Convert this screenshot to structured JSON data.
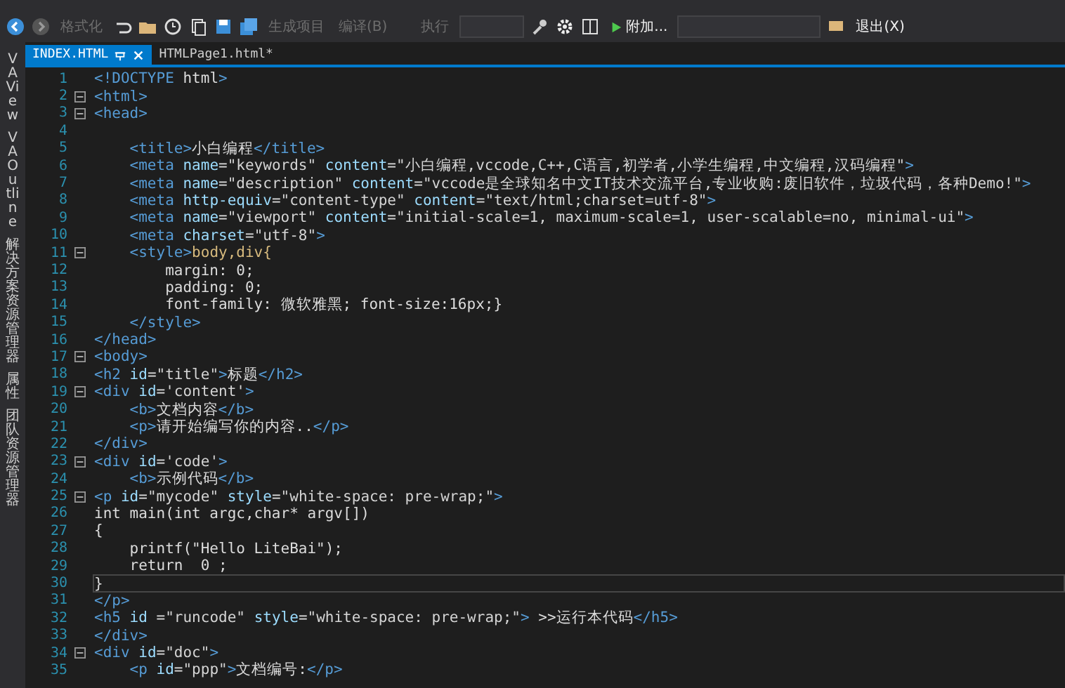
{
  "toolbar": {
    "format_button": {
      "label": "格式化",
      "disabled": true
    },
    "build_button": {
      "label": "生成项目",
      "disabled": true
    },
    "compile_button": {
      "label": "编译(B)",
      "disabled": true
    },
    "run_button": {
      "label": "执行",
      "disabled": true
    },
    "attach_button": {
      "label": "附加...",
      "disabled": false
    },
    "exit_button": {
      "label": "退出(X)",
      "disabled": false
    }
  },
  "side_tabs": [
    "VA View",
    "VA Outline",
    "解决方案资源管理器",
    "属性",
    "团队资源管理器"
  ],
  "editor_tabs": [
    {
      "label": "INDEX.HTML",
      "selected": true
    },
    {
      "label": "HTMLPage1.html*",
      "selected": false
    }
  ],
  "code_lines": [
    {
      "number": "1",
      "fold": false,
      "current": false,
      "tokens": [
        {
          "kind": "tag",
          "text": "<!DOCTYPE"
        },
        {
          "kind": "text",
          "text": " html"
        },
        {
          "kind": "tag",
          "text": ">"
        }
      ]
    },
    {
      "number": "2",
      "fold": true,
      "current": false,
      "tokens": [
        {
          "kind": "tag",
          "text": "<html>"
        }
      ]
    },
    {
      "number": "3",
      "fold": true,
      "current": false,
      "tokens": [
        {
          "kind": "tag",
          "text": "<head>"
        }
      ]
    },
    {
      "number": "4",
      "fold": false,
      "current": false
    },
    {
      "number": "5",
      "fold": false,
      "current": false,
      "tokens": [
        {
          "kind": "tag",
          "text": "    <title>"
        },
        {
          "kind": "text",
          "text": "小白编程"
        },
        {
          "kind": "tag",
          "text": "</title>"
        }
      ]
    },
    {
      "number": "6",
      "fold": false,
      "current": false,
      "tokens": [
        {
          "kind": "tag",
          "text": "    <meta"
        },
        {
          "kind": "attr",
          "text": " name"
        },
        {
          "kind": "text",
          "text": "="
        },
        {
          "kind": "str",
          "text": "\"keywords\""
        },
        {
          "kind": "attr",
          "text": " content"
        },
        {
          "kind": "text",
          "text": "="
        },
        {
          "kind": "str",
          "text": "\"小白编程,vccode,C++,C语言,初学者,小学生编程,中文编程,汉码编程\""
        },
        {
          "kind": "tag",
          "text": ">"
        }
      ]
    },
    {
      "number": "7",
      "fold": false,
      "current": false,
      "tokens": [
        {
          "kind": "tag",
          "text": "    <meta"
        },
        {
          "kind": "attr",
          "text": " name"
        },
        {
          "kind": "text",
          "text": "="
        },
        {
          "kind": "str",
          "text": "\"description\""
        },
        {
          "kind": "attr",
          "text": " content"
        },
        {
          "kind": "text",
          "text": "="
        },
        {
          "kind": "str",
          "text": "\"vccode是全球知名中文IT技术交流平台,专业收购:废旧软件，垃圾代码，各种Demo!\""
        },
        {
          "kind": "tag",
          "text": ">"
        }
      ]
    },
    {
      "number": "8",
      "fold": false,
      "current": false,
      "tokens": [
        {
          "kind": "tag",
          "text": "    <meta"
        },
        {
          "kind": "attr",
          "text": " http-equiv"
        },
        {
          "kind": "text",
          "text": "="
        },
        {
          "kind": "str",
          "text": "\"content-type\""
        },
        {
          "kind": "attr",
          "text": " content"
        },
        {
          "kind": "text",
          "text": "="
        },
        {
          "kind": "str",
          "text": "\"text/html;charset=utf-8\""
        },
        {
          "kind": "tag",
          "text": ">"
        }
      ]
    },
    {
      "number": "9",
      "fold": false,
      "current": false,
      "tokens": [
        {
          "kind": "tag",
          "text": "    <meta"
        },
        {
          "kind": "attr",
          "text": " name"
        },
        {
          "kind": "text",
          "text": "="
        },
        {
          "kind": "str",
          "text": "\"viewport\""
        },
        {
          "kind": "attr",
          "text": " content"
        },
        {
          "kind": "text",
          "text": "="
        },
        {
          "kind": "str",
          "text": "\"initial-scale=1, maximum-scale=1, user-scalable=no, minimal-ui\""
        },
        {
          "kind": "tag",
          "text": ">"
        }
      ]
    },
    {
      "number": "10",
      "fold": false,
      "current": false,
      "tokens": [
        {
          "kind": "tag",
          "text": "    <meta"
        },
        {
          "kind": "attr",
          "text": " charset"
        },
        {
          "kind": "text",
          "text": "="
        },
        {
          "kind": "str",
          "text": "\"utf-8\""
        },
        {
          "kind": "tag",
          "text": ">"
        }
      ]
    },
    {
      "number": "11",
      "fold": true,
      "current": false,
      "tokens": [
        {
          "kind": "tag",
          "text": "    <style>"
        },
        {
          "kind": "css",
          "text": "body,div{"
        }
      ]
    },
    {
      "number": "12",
      "fold": false,
      "current": false,
      "tokens": [
        {
          "kind": "text",
          "text": "        margin: 0;"
        }
      ]
    },
    {
      "number": "13",
      "fold": false,
      "current": false,
      "tokens": [
        {
          "kind": "text",
          "text": "        padding: 0;"
        }
      ]
    },
    {
      "number": "14",
      "fold": false,
      "current": false,
      "tokens": [
        {
          "kind": "text",
          "text": "        font-family: 微软雅黑; font-size:16px;}"
        }
      ]
    },
    {
      "number": "15",
      "fold": false,
      "current": false,
      "tokens": [
        {
          "kind": "tag",
          "text": "    </style>"
        }
      ]
    },
    {
      "number": "16",
      "fold": false,
      "current": false,
      "tokens": [
        {
          "kind": "tag",
          "text": "</head>"
        }
      ]
    },
    {
      "number": "17",
      "fold": true,
      "current": false,
      "tokens": [
        {
          "kind": "tag",
          "text": "<body>"
        }
      ]
    },
    {
      "number": "18",
      "fold": false,
      "current": false,
      "tokens": [
        {
          "kind": "tag",
          "text": "<h2"
        },
        {
          "kind": "attr",
          "text": " id"
        },
        {
          "kind": "text",
          "text": "="
        },
        {
          "kind": "str",
          "text": "\"title\""
        },
        {
          "kind": "tag",
          "text": ">"
        },
        {
          "kind": "text",
          "text": "标题"
        },
        {
          "kind": "tag",
          "text": "</h2>"
        }
      ]
    },
    {
      "number": "19",
      "fold": true,
      "current": false,
      "tokens": [
        {
          "kind": "tag",
          "text": "<div"
        },
        {
          "kind": "attr",
          "text": " id"
        },
        {
          "kind": "text",
          "text": "="
        },
        {
          "kind": "str",
          "text": "'content'"
        },
        {
          "kind": "tag",
          "text": ">"
        }
      ]
    },
    {
      "number": "20",
      "fold": false,
      "current": false,
      "tokens": [
        {
          "kind": "tag",
          "text": "    <b>"
        },
        {
          "kind": "text",
          "text": "文档内容"
        },
        {
          "kind": "tag",
          "text": "</b>"
        }
      ]
    },
    {
      "number": "21",
      "fold": false,
      "current": false,
      "tokens": [
        {
          "kind": "tag",
          "text": "    <p>"
        },
        {
          "kind": "text",
          "text": "请开始编写你的内容.."
        },
        {
          "kind": "tag",
          "text": "</p>"
        }
      ]
    },
    {
      "number": "22",
      "fold": false,
      "current": false,
      "tokens": [
        {
          "kind": "tag",
          "text": "</div>"
        }
      ]
    },
    {
      "number": "23",
      "fold": true,
      "current": false,
      "tokens": [
        {
          "kind": "tag",
          "text": "<div"
        },
        {
          "kind": "attr",
          "text": " id"
        },
        {
          "kind": "text",
          "text": "="
        },
        {
          "kind": "str",
          "text": "'code'"
        },
        {
          "kind": "tag",
          "text": ">"
        }
      ]
    },
    {
      "number": "24",
      "fold": false,
      "current": false,
      "tokens": [
        {
          "kind": "tag",
          "text": "    <b>"
        },
        {
          "kind": "text",
          "text": "示例代码"
        },
        {
          "kind": "tag",
          "text": "</b>"
        }
      ]
    },
    {
      "number": "25",
      "fold": true,
      "current": false,
      "tokens": [
        {
          "kind": "tag",
          "text": "<p"
        },
        {
          "kind": "attr",
          "text": " id"
        },
        {
          "kind": "text",
          "text": "="
        },
        {
          "kind": "str",
          "text": "\"mycode\""
        },
        {
          "kind": "attr",
          "text": " style"
        },
        {
          "kind": "text",
          "text": "="
        },
        {
          "kind": "str",
          "text": "\"white-space: pre-wrap;\""
        },
        {
          "kind": "tag",
          "text": ">"
        }
      ]
    },
    {
      "number": "26",
      "fold": false,
      "current": false,
      "tokens": [
        {
          "kind": "text",
          "text": "int main(int argc,char* argv[])"
        }
      ]
    },
    {
      "number": "27",
      "fold": false,
      "current": false,
      "tokens": [
        {
          "kind": "text",
          "text": "{"
        }
      ]
    },
    {
      "number": "28",
      "fold": false,
      "current": false,
      "tokens": [
        {
          "kind": "text",
          "text": "    printf(\"Hello LiteBai\");"
        }
      ]
    },
    {
      "number": "29",
      "fold": false,
      "current": false,
      "tokens": [
        {
          "kind": "text",
          "text": "    return  0 ;"
        }
      ]
    },
    {
      "number": "30",
      "fold": false,
      "current": true,
      "tokens": [
        {
          "kind": "text",
          "text": "}"
        }
      ]
    },
    {
      "number": "31",
      "fold": false,
      "current": false,
      "tokens": [
        {
          "kind": "tag",
          "text": "</p>"
        }
      ]
    },
    {
      "number": "32",
      "fold": false,
      "current": false,
      "tokens": [
        {
          "kind": "tag",
          "text": "<h5"
        },
        {
          "kind": "attr",
          "text": " id "
        },
        {
          "kind": "text",
          "text": "="
        },
        {
          "kind": "str",
          "text": "\"runcode\""
        },
        {
          "kind": "attr",
          "text": " style"
        },
        {
          "kind": "text",
          "text": "="
        },
        {
          "kind": "str",
          "text": "\"white-space: pre-wrap;\""
        },
        {
          "kind": "tag",
          "text": ">"
        },
        {
          "kind": "text",
          "text": " >>运行本代码"
        },
        {
          "kind": "tag",
          "text": "</h5>"
        }
      ]
    },
    {
      "number": "33",
      "fold": false,
      "current": false,
      "tokens": [
        {
          "kind": "tag",
          "text": "</div>"
        }
      ]
    },
    {
      "number": "34",
      "fold": true,
      "current": false,
      "tokens": [
        {
          "kind": "tag",
          "text": "<div"
        },
        {
          "kind": "attr",
          "text": " id"
        },
        {
          "kind": "text",
          "text": "="
        },
        {
          "kind": "str",
          "text": "\"doc\""
        },
        {
          "kind": "tag",
          "text": ">"
        }
      ]
    },
    {
      "number": "35",
      "fold": false,
      "current": false,
      "tokens": [
        {
          "kind": "tag",
          "text": "    <p"
        },
        {
          "kind": "attr",
          "text": " id"
        },
        {
          "kind": "text",
          "text": "="
        },
        {
          "kind": "str",
          "text": "\"ppp\""
        },
        {
          "kind": "tag",
          "text": ">"
        },
        {
          "kind": "text",
          "text": "文档编号:"
        },
        {
          "kind": "tag",
          "text": "</p>"
        }
      ]
    }
  ]
}
